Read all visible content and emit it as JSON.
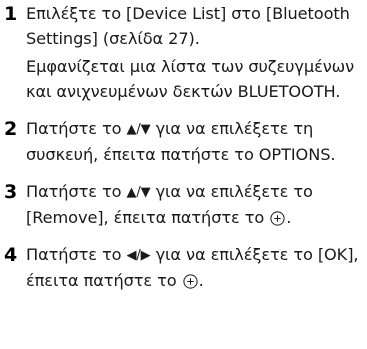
{
  "steps": [
    {
      "number": "1",
      "text": "Επιλέξτε το [Device List] στο [Bluetooth Settings] (σελίδα 27).",
      "note": "Εμφανίζεται μια λίστα των συζευγμένων και ανιχνευμένων δεκτών BLUETOOTH."
    },
    {
      "number": "2",
      "before": "Πατήστε το ",
      "arrows": "▲/▼",
      "after": " για να επιλέξετε τη συσκευή, έπειτα πατήστε το OPTIONS."
    },
    {
      "number": "3",
      "before": "Πατήστε το ",
      "arrows": "▲/▼",
      "middle": " για να επιλέξετε το [Remove], έπειτα πατήστε το ",
      "end": "."
    },
    {
      "number": "4",
      "before": "Πατήστε το ",
      "arrows": "◀/▶",
      "middle": " για να επιλέξετε το [OK], έπειτα πατήστε το ",
      "end": "."
    }
  ],
  "icons": {
    "enter": "circle-plus-icon"
  }
}
